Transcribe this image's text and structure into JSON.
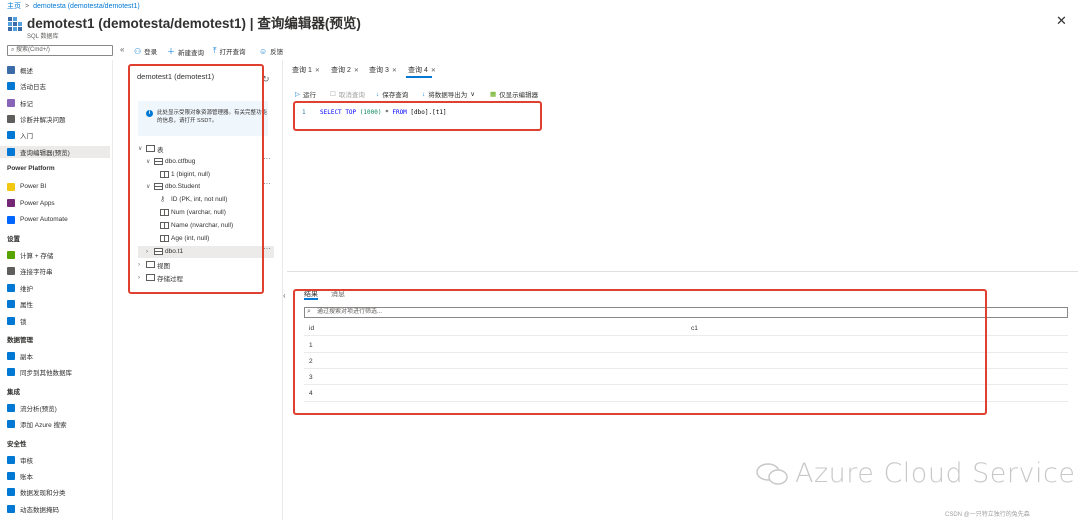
{
  "breadcrumb": {
    "home": "主页",
    "current": "demotesta (demotesta/demotest1)"
  },
  "header": {
    "title": "demotest1 (demotesta/demotest1) | 查询编辑器(预览)",
    "subtitle": "SQL 数据库",
    "more": "···",
    "close": "✕"
  },
  "commandbar": {
    "search_placeholder": "搜索(Cmd+/)",
    "collapse": "«",
    "login": "登录",
    "new_query": "新建查询",
    "open_query": "打开查询",
    "feedback": "反馈"
  },
  "nav": {
    "top_items": [
      {
        "label": "概述",
        "icon": "sql-db-icon",
        "color": "#3b6ca8"
      },
      {
        "label": "活动日志",
        "icon": "activity-log-icon",
        "color": "#0078d4"
      },
      {
        "label": "标记",
        "icon": "tag-icon",
        "color": "#8764b8"
      },
      {
        "label": "诊断并解决问题",
        "icon": "wrench-icon",
        "color": "#605e5c"
      },
      {
        "label": "入门",
        "icon": "quickstart-icon",
        "color": "#0078d4"
      },
      {
        "label": "查询编辑器(预览)",
        "icon": "query-editor-icon",
        "color": "#0078d4"
      }
    ],
    "sections": [
      {
        "title": "Power Platform",
        "items": [
          {
            "label": "Power BI",
            "icon": "power-bi-icon",
            "color": "#f2c811"
          },
          {
            "label": "Power Apps",
            "icon": "power-apps-icon",
            "color": "#742774"
          },
          {
            "label": "Power Automate",
            "icon": "power-automate-icon",
            "color": "#0066ff"
          }
        ]
      },
      {
        "title": "设置",
        "items": [
          {
            "label": "计算 + 存储",
            "icon": "compute-icon",
            "color": "#57a300"
          },
          {
            "label": "连接字符串",
            "icon": "connection-icon",
            "color": "#605e5c"
          },
          {
            "label": "维护",
            "icon": "maintenance-icon",
            "color": "#0078d4"
          },
          {
            "label": "属性",
            "icon": "properties-icon",
            "color": "#0078d4"
          },
          {
            "label": "锁",
            "icon": "lock-icon",
            "color": "#0078d4"
          }
        ]
      },
      {
        "title": "数据管理",
        "items": [
          {
            "label": "副本",
            "icon": "replica-icon",
            "color": "#0078d4"
          },
          {
            "label": "同步到其他数据库",
            "icon": "sync-icon",
            "color": "#0078d4"
          }
        ]
      },
      {
        "title": "集成",
        "items": [
          {
            "label": "流分析(预览)",
            "icon": "stream-icon",
            "color": "#0078d4"
          },
          {
            "label": "添加 Azure 搜索",
            "icon": "cloud-search-icon",
            "color": "#0078d4"
          }
        ]
      },
      {
        "title": "安全性",
        "items": [
          {
            "label": "审核",
            "icon": "audit-icon",
            "color": "#0078d4"
          },
          {
            "label": "账本",
            "icon": "ledger-icon",
            "color": "#0078d4"
          },
          {
            "label": "数据发现和分类",
            "icon": "discovery-icon",
            "color": "#0078d4"
          },
          {
            "label": "动态数据掩码",
            "icon": "masking-icon",
            "color": "#0078d4"
          }
        ]
      }
    ]
  },
  "explorer": {
    "title": "demotest1 (demotest1)",
    "info": "此处显示受限对象资源管理器。有关完整功能的信息，请打开 SSDT。",
    "tables_label": "表",
    "tables": [
      {
        "name": "dbo.ctfbug",
        "columns": [
          "1 (bigint, null)"
        ]
      },
      {
        "name": "dbo.Student",
        "columns": [
          "ID (PK, int, not null)",
          "Num (varchar, null)",
          "Name (nvarchar, null)",
          "Age (int, null)"
        ]
      }
    ],
    "selected_table": "dbo.t1",
    "views_label": "视图",
    "procs_label": "存储过程"
  },
  "query_tabs": [
    "查询 1",
    "查询 2",
    "查询 3",
    "查询 4"
  ],
  "toolbar": {
    "run": "运行",
    "cancel": "取消查询",
    "save": "保存查询",
    "export": "将数据导出为",
    "show_editor": "仅显示编辑器"
  },
  "editor": {
    "line_number": "1",
    "select": "SELECT",
    "top": "TOP",
    "limit": "(1000)",
    "star": "*",
    "from": "FROM",
    "object": "[dbo].[t1]"
  },
  "results": {
    "tabs": [
      "结果",
      "消息"
    ],
    "filter_placeholder": "通过搜索对项进行筛选...",
    "columns": [
      "id",
      "c1"
    ],
    "rows": [
      [
        "1",
        ""
      ],
      [
        "2",
        ""
      ],
      [
        "3",
        ""
      ],
      [
        "4",
        ""
      ]
    ]
  },
  "watermark": {
    "text": "Azure Cloud Service",
    "csdn": "CSDN @一只特立独行的兔先森"
  },
  "colors": {
    "accent": "#0078d4",
    "annotation": "#e0402f"
  }
}
